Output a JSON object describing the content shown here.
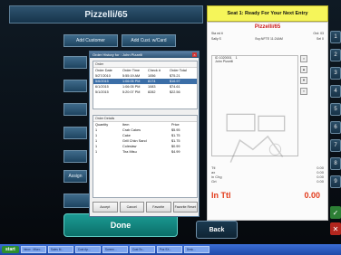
{
  "left_header": {
    "title": "Pizzelli/65"
  },
  "seat_bar": {
    "text": "Seat 1: Ready For Your Next Entry"
  },
  "ticket": {
    "title": "Pizzelli/65",
    "sub_left": "Sta ed ti",
    "sub_right": "Ord: 03",
    "row1_left": "Sally S",
    "row1_mid": "Svy:NFTE 11:24AM",
    "row1_right": "Sel 0",
    "line1_id": "ID 1020001",
    "line1_qty": "1",
    "line2": "John Pizzelli",
    "totals": [
      {
        "label": "Ttl",
        "value": "0.00"
      },
      {
        "label": "ax",
        "value": "0.00"
      },
      {
        "label": "in Chg",
        "value": "0.00"
      },
      {
        "label": "Grt",
        "value": "0.00"
      }
    ],
    "in_ttl_label": "In Ttl",
    "in_ttl_value": "0.00"
  },
  "num_col": [
    "1",
    "2",
    "3",
    "4",
    "5",
    "6",
    "7",
    "8",
    "9"
  ],
  "left_buttons": {
    "add_customer": "Add Customer",
    "add_cust_card": "Add Cust. w/Card",
    "assign": "Assign"
  },
  "done_label": "Done",
  "back_label": "Back",
  "taskbar": {
    "start": "start",
    "items": [
      "Inbox - Micro...",
      "Sales M...",
      "Cust Ap...",
      "Screen...",
      "Cust Sv...",
      "Pos SX...",
      "Desk..."
    ]
  },
  "dialog": {
    "title": "Order History for : John Pizzelli",
    "orders_caption": "Order",
    "columns": [
      "Order Date",
      "Order Time",
      "Check #",
      "Order Total"
    ],
    "rows": [
      [
        "5/27/2010",
        "5:55:19 AM",
        "1056",
        "$75.21"
      ],
      [
        "5/6/2015",
        "1:06:05 PM",
        "8174",
        "$16.97"
      ],
      [
        "6/1/2015",
        "1:06:05 PM",
        "1083",
        "$74.61"
      ],
      [
        "5/1/2015",
        "5:20:07 PM",
        "8282",
        "$22.56"
      ]
    ],
    "selected_row": 1,
    "details_caption": "Order Details",
    "detail_columns": [
      "Quantity",
      "Item",
      "Price"
    ],
    "detail_rows": [
      [
        "1",
        "Crab Cakes",
        "$5.95"
      ],
      [
        "1",
        "Cake",
        "$1.75"
      ],
      [
        "1",
        "Grill Chkn Sand",
        "$1.75"
      ],
      [
        "1",
        "Coleslaw",
        "$0.99"
      ],
      [
        "1",
        "Tira Mtsu",
        "$4.99"
      ]
    ],
    "buttons": [
      "Accept",
      "Cancel",
      "Favorite",
      "Favorite Reset"
    ]
  }
}
